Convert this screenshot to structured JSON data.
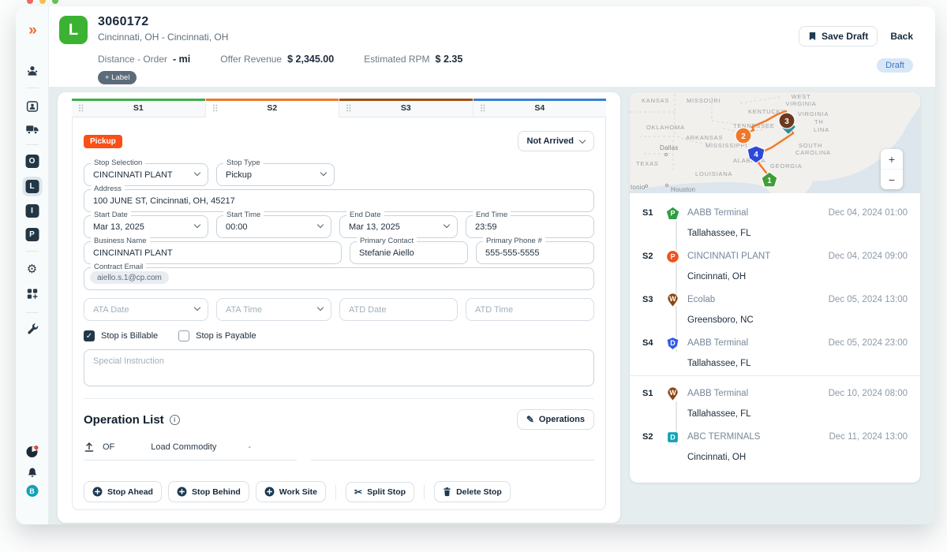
{
  "window": {
    "traffic_light_colors": [
      "#ed6a5e",
      "#f5bf4f",
      "#61c554"
    ]
  },
  "sidebar": {
    "logo_glyph": "»",
    "letter_items": [
      "O",
      "L",
      "I",
      "P"
    ],
    "active_item": "L",
    "bottom_letter": "B"
  },
  "header": {
    "load_badge_letter": "L",
    "order_id": "3060172",
    "route_summary": "Cincinnati, OH - Cincinnati, OH",
    "metrics": [
      {
        "label": "Distance - Order",
        "value": "- mi"
      },
      {
        "label": "Offer Revenue",
        "value": "$ 2,345.00"
      },
      {
        "label": "Estimated RPM",
        "value": "$ 2.35"
      }
    ],
    "add_label_button": "+ Label",
    "save_draft_button": "Save Draft",
    "back_button": "Back",
    "status_badge": "Draft"
  },
  "tabs": [
    {
      "label": "S1",
      "color": "#3fae49"
    },
    {
      "label": "S2",
      "color": "#f0782a",
      "active": true
    },
    {
      "label": "S3",
      "color": "#9c5214"
    },
    {
      "label": "S4",
      "color": "#3a7fd5"
    }
  ],
  "stop_form": {
    "type_badge": "Pickup",
    "type_badge_color": "#fa4f17",
    "arrival_status": "Not Arrived",
    "fields": {
      "stop_selection": {
        "label": "Stop Selection",
        "value": "CINCINNATI PLANT"
      },
      "stop_type": {
        "label": "Stop Type",
        "value": "Pickup"
      },
      "address": {
        "label": "Address",
        "value": "100 JUNE ST, Cincinnati, OH, 45217"
      },
      "start_date": {
        "label": "Start Date",
        "value": "Mar 13, 2025"
      },
      "start_time": {
        "label": "Start Time",
        "value": "00:00"
      },
      "end_date": {
        "label": "End Date",
        "value": "Mar 13, 2025"
      },
      "end_time": {
        "label": "End Time",
        "value": "23:59"
      },
      "business_name": {
        "label": "Business Name",
        "value": "CINCINNATI PLANT"
      },
      "primary_contact": {
        "label": "Primary Contact",
        "value": "Stefanie Aiello"
      },
      "primary_phone": {
        "label": "Primary Phone #",
        "value": "555-555-5555"
      },
      "contract_email": {
        "label": "Contract Email",
        "value": "aiello.s.1@cp.com"
      },
      "ata_date": {
        "placeholder": "ATA Date"
      },
      "ata_time": {
        "placeholder": "ATA Time"
      },
      "atd_date": {
        "placeholder": "ATD Date"
      },
      "atd_time": {
        "placeholder": "ATD Time"
      },
      "special_instruction": {
        "placeholder": "Special Instruction"
      }
    },
    "checkboxes": [
      {
        "label": "Stop is Billable",
        "checked": true,
        "check_glyph": "✓"
      },
      {
        "label": "Stop is Payable",
        "checked": false
      }
    ],
    "operation_list": {
      "title": "Operation List",
      "info_glyph": "i",
      "edit_button": "Operations",
      "row": {
        "code": "OF",
        "commodity_label": "Load Commodity",
        "value": "-"
      }
    },
    "actions": [
      "Stop Ahead",
      "Stop Behind",
      "Work Site",
      "Split Stop",
      "Delete Stop"
    ]
  },
  "map": {
    "route_color": "#ee7b2d",
    "state_labels": [
      "KANSAS",
      "MISSOURI",
      "WEST",
      "VIRGINIA",
      "KENTUCKY",
      "VIRGINIA",
      "OKLAHOMA",
      "TENNESSEE",
      "ARKANSAS",
      "TH",
      "LINA",
      "MISSISSIPPI",
      "SOUTH",
      "CAROLINA",
      "ALABAMA",
      "GEORGIA",
      "TEXAS",
      "LOUISIANA"
    ],
    "city_labels": [
      "Dallas",
      "tonio",
      "Houston"
    ],
    "markers": [
      {
        "label": "1",
        "shape": "pentagon",
        "color": "#3f9e35"
      },
      {
        "label": "2",
        "shape": "circle",
        "color": "#f0782a"
      },
      {
        "label": "3",
        "shape": "circle",
        "color": "#6b3a1e",
        "backing_color": "#2f8f99"
      },
      {
        "label": "4",
        "shape": "shield",
        "color": "#2e49d8"
      }
    ],
    "zoom_in_label": "+",
    "zoom_out_label": "−"
  },
  "stop_list": {
    "groups": [
      {
        "rows": [
          {
            "code": "S1",
            "marker_letter": "P",
            "marker_color": "#2f9e41",
            "marker_shape": "pentagon",
            "name": "AABB Terminal",
            "city": "Tallahassee, FL",
            "datetime": "Dec 04, 2024 01:00"
          },
          {
            "code": "S2",
            "marker_letter": "P",
            "marker_color": "#f4511e",
            "marker_shape": "circle",
            "name": "CINCINNATI PLANT",
            "city": "Cincinnati, OH",
            "datetime": "Dec 04, 2024 09:00"
          },
          {
            "code": "S3",
            "marker_letter": "W",
            "marker_color": "#8a4513",
            "marker_shape": "pin",
            "name": "Ecolab",
            "city": "Greensboro, NC",
            "datetime": "Dec 05, 2024 13:00"
          },
          {
            "code": "S4",
            "marker_letter": "D",
            "marker_color": "#2e5bea",
            "marker_shape": "shield",
            "name": "AABB Terminal",
            "city": "Tallahassee, FL",
            "datetime": "Dec 05, 2024 23:00"
          }
        ]
      },
      {
        "rows": [
          {
            "code": "S1",
            "marker_letter": "W",
            "marker_color": "#8a4513",
            "marker_shape": "pin",
            "name": "AABB Terminal",
            "city": "Tallahassee, FL",
            "datetime": "Dec 10, 2024 08:00"
          },
          {
            "code": "S2",
            "marker_letter": "D",
            "marker_color": "#11a3b5",
            "marker_shape": "square",
            "name": "ABC TERMINALS",
            "city": "Cincinnati, OH",
            "datetime": "Dec 11, 2024 13:00"
          }
        ]
      }
    ]
  }
}
